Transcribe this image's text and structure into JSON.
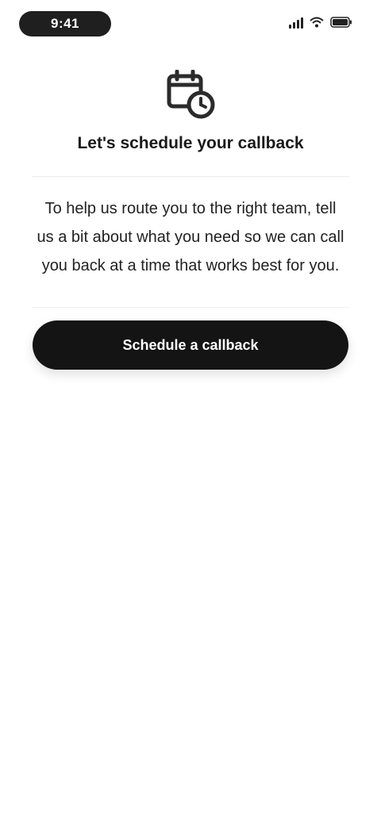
{
  "status_bar": {
    "time": "9:41"
  },
  "screen": {
    "icon": "calendar-phone-icon",
    "heading": "Let's schedule your callback",
    "body": "To help us route you to the right team, tell us a bit about what you need so we can call you back at a time that works best for you.",
    "button_label": "Schedule a callback"
  },
  "colors": {
    "background": "#ffffff",
    "button": "#141414",
    "button_text": "#ffffff",
    "text": "#1a1a1a"
  }
}
